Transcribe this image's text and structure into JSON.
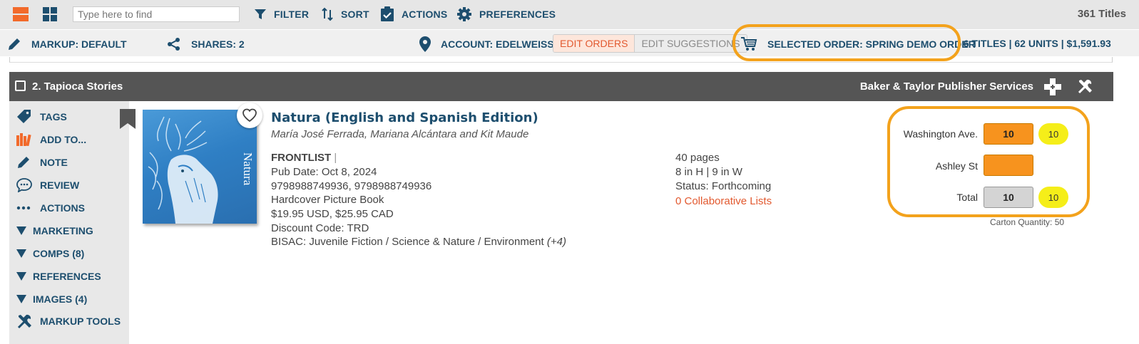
{
  "toolbar": {
    "search_placeholder": "Type here to find",
    "filter": "FILTER",
    "sort": "SORT",
    "actions": "ACTIONS",
    "preferences": "PREFERENCES",
    "titles_count": "361 Titles"
  },
  "bar2": {
    "markup": "MARKUP: DEFAULT",
    "shares": "SHARES: 2",
    "account": "ACCOUNT: EDELWEISS",
    "edit_orders": "EDIT ORDERS",
    "edit_suggestions": "EDIT SUGGESTIONS",
    "selected_order": "SELECTED ORDER: SPRING DEMO ORDER",
    "order_summary": "| 6 TITLES | 62 UNITS | $1,591.93"
  },
  "title_row": {
    "title": "2. Tapioca Stories",
    "publisher": "Baker & Taylor Publisher Services"
  },
  "sidebar": {
    "items": [
      "TAGS",
      "ADD TO...",
      "NOTE",
      "REVIEW",
      "ACTIONS",
      "MARKETING",
      "COMPS (8)",
      "REFERENCES",
      "IMAGES (4)",
      "MARKUP TOOLS"
    ]
  },
  "book": {
    "title": "Natura (English and Spanish Edition)",
    "authors": "María José Ferrada, Mariana Alcántara and Kit Maude",
    "cover_title": "Natura",
    "frontlist": "FRONTLIST",
    "frontlist_sep": "|",
    "pub_date": "Pub Date: Oct 8, 2024",
    "isbns": "9798988749936, 9798988749936",
    "format": "Hardcover Picture Book",
    "price": "$19.95 USD, $25.95 CAD",
    "discount": "Discount Code: TRD",
    "bisac": "BISAC: Juvenile Fiction / Science & Nature / Environment",
    "bisac_more": "(+4)",
    "pages": "40 pages",
    "dimensions": "8 in H | 9 in W",
    "status": "Status: Forthcoming",
    "collab_lists": "0 Collaborative Lists"
  },
  "order": {
    "rows": [
      {
        "label": "Washington Ave.",
        "qty": "10",
        "badge": "10"
      },
      {
        "label": "Ashley St",
        "qty": "",
        "badge": ""
      },
      {
        "label": "Total",
        "qty": "10",
        "badge": "10"
      }
    ],
    "carton": "Carton Quantity: 50"
  },
  "colors": {
    "accent_orange": "#f7931e",
    "brand_blue": "#1d4e6e",
    "highlight_ring": "#f3a21c",
    "badge_yellow": "#f5ee19"
  }
}
